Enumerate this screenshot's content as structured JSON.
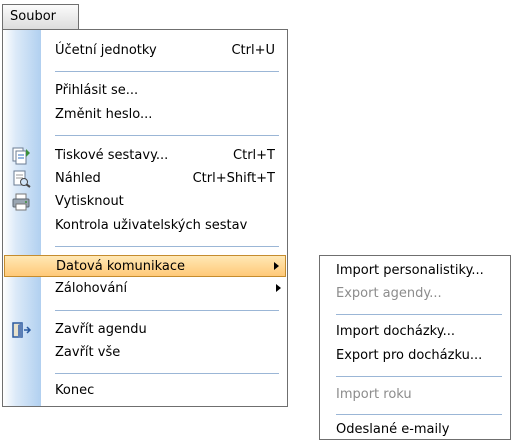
{
  "menubar": {
    "title": "Soubor"
  },
  "main_menu": {
    "items": [
      {
        "label": "Účetní jednotky",
        "shortcut": "Ctrl+U"
      },
      {
        "label": "Přihlásit se..."
      },
      {
        "label": "Změnit heslo..."
      },
      {
        "label": "Tiskové sestavy...",
        "shortcut": "Ctrl+T",
        "icon": "print-reports-icon"
      },
      {
        "label": "Náhled",
        "shortcut": "Ctrl+Shift+T",
        "icon": "print-preview-icon"
      },
      {
        "label": "Vytisknout",
        "icon": "printer-icon"
      },
      {
        "label": "Kontrola uživatelských sestav"
      },
      {
        "label": "Datová komunikace",
        "submenu": true,
        "state": "highlighted"
      },
      {
        "label": "Zálohování",
        "submenu": true
      },
      {
        "label": "Zavřít agendu",
        "icon": "close-agenda-icon"
      },
      {
        "label": "Zavřít vše"
      },
      {
        "label": "Konec"
      }
    ]
  },
  "sub_menu": {
    "items": [
      {
        "label": "Import personalistiky...",
        "enabled": true
      },
      {
        "label": "Export agendy...",
        "enabled": false
      },
      {
        "label": "Import docházky...",
        "enabled": true
      },
      {
        "label": "Export pro docházku...",
        "enabled": true
      },
      {
        "label": "Import roku",
        "enabled": false
      },
      {
        "label": "Odeslané e-maily",
        "enabled": true
      }
    ]
  },
  "colors": {
    "highlight_top": "#ffe8b5",
    "highlight_bottom": "#ffc978",
    "highlight_border": "#c58c2e",
    "gutter": "#b1d0f0",
    "separator": "#9bb6d6",
    "disabled_text": "#8c8c8c"
  }
}
